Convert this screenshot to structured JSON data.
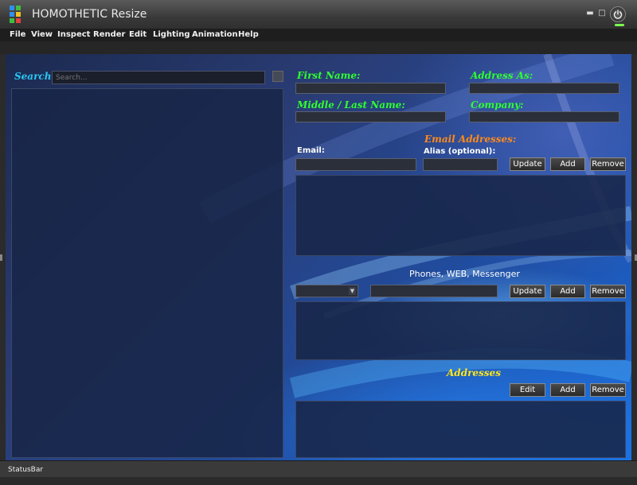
{
  "window": {
    "title": "HOMOTHETIC Resize",
    "minimize_glyph": "▬",
    "maximize_glyph": "□"
  },
  "menu": {
    "items": [
      "File",
      "View",
      "Inspect",
      "Render",
      "Edit",
      "Lighting",
      "Animation",
      "Help"
    ]
  },
  "search": {
    "label": "Search",
    "placeholder": "Search..."
  },
  "contact_form": {
    "first_name_label": "First Name:",
    "address_as_label": "Address As:",
    "middle_last_label": "Middle / Last Name:",
    "company_label": "Company:"
  },
  "email": {
    "section_label": "Email Addresses:",
    "email_label": "Email:",
    "alias_label": "Alias (optional):",
    "update_label": "Update",
    "add_label": "Add",
    "remove_label": "Remove"
  },
  "phones": {
    "section_label": "Phones, WEB, Messenger",
    "update_label": "Update",
    "add_label": "Add",
    "remove_label": "Remove"
  },
  "addresses": {
    "section_label": "Addresses",
    "edit_label": "Edit",
    "add_label": "Add",
    "remove_label": "Remove"
  },
  "statusbar": {
    "text": "StatusBar"
  },
  "colors": {
    "accent_green": "#2fff2f",
    "accent_orange": "#ff8a1a",
    "accent_yellow": "#ffe81a",
    "search_cyan": "#29c7f2",
    "power_led": "#7dff4f"
  },
  "icons": {
    "app": "app-grid-icon",
    "power": "power-icon"
  }
}
